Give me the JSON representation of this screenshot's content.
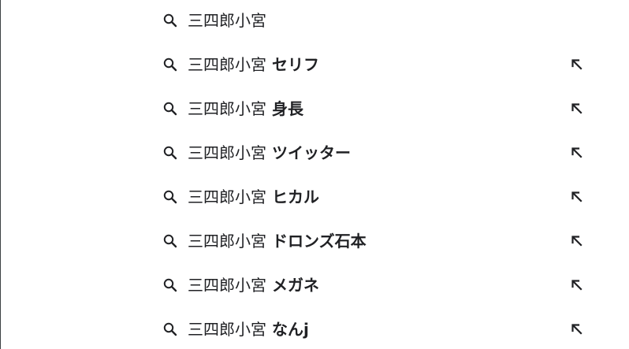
{
  "suggestions": [
    {
      "base": "三四郎小宮",
      "suffix": "",
      "has_fill": false
    },
    {
      "base": "三四郎小宮",
      "suffix": " セリフ",
      "has_fill": true
    },
    {
      "base": "三四郎小宮",
      "suffix": " 身長",
      "has_fill": true
    },
    {
      "base": "三四郎小宮",
      "suffix": " ツイッター",
      "has_fill": true
    },
    {
      "base": "三四郎小宮",
      "suffix": " ヒカル",
      "has_fill": true
    },
    {
      "base": "三四郎小宮",
      "suffix": " ドロンズ石本",
      "has_fill": true
    },
    {
      "base": "三四郎小宮",
      "suffix": " メガネ",
      "has_fill": true
    },
    {
      "base": "三四郎小宮",
      "suffix": " なんj",
      "has_fill": true
    }
  ],
  "icons": {
    "search": "search-icon",
    "fill": "arrow-up-left-icon"
  },
  "colors": {
    "text": "#202124",
    "icon": "#202124",
    "background": "#ffffff"
  }
}
